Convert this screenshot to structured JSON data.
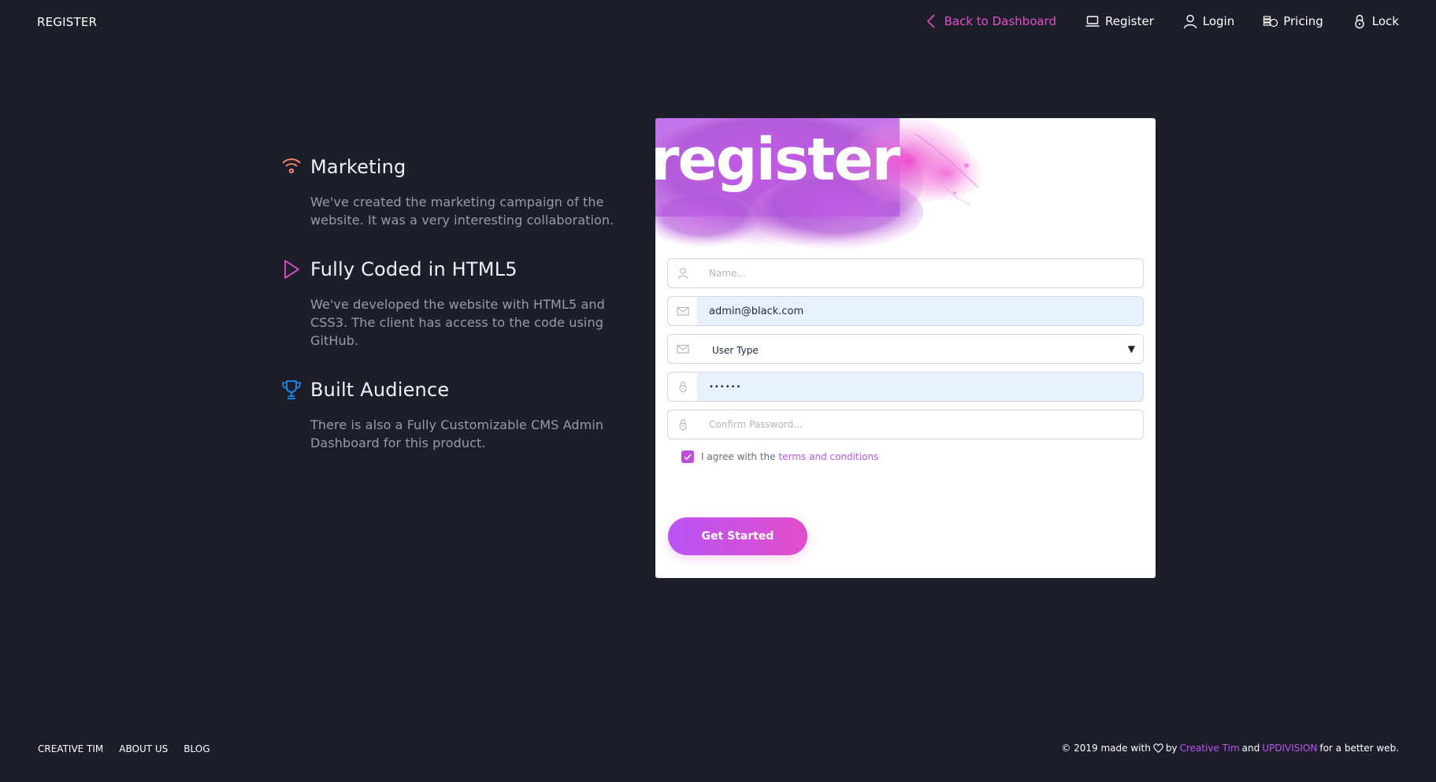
{
  "navbar": {
    "brand": "REGISTER",
    "items": [
      {
        "label": "Back to Dashboard",
        "icon": "chevron-left-icon",
        "color": "#e14eca"
      },
      {
        "label": "Register",
        "icon": "laptop-icon"
      },
      {
        "label": "Login",
        "icon": "user-icon"
      },
      {
        "label": "Pricing",
        "icon": "coins-icon"
      },
      {
        "label": "Lock",
        "icon": "lock-icon"
      }
    ]
  },
  "info": [
    {
      "title": "Marketing",
      "description": "We've created the marketing campaign of the website. It was a very interesting collaboration.",
      "icon": "wifi-icon",
      "icon_color": "#ff8d72"
    },
    {
      "title": "Fully Coded in HTML5",
      "description": "We've developed the website with HTML5 and CSS3. The client has access to the code using GitHub.",
      "icon": "play-icon",
      "icon_color": "#e14eca"
    },
    {
      "title": "Built Audience",
      "description": "There is also a Fully Customizable CMS Admin Dashboard for this product.",
      "icon": "trophy-icon",
      "icon_color": "#1d8cf8"
    }
  ],
  "card": {
    "title": "register",
    "fields": {
      "name": {
        "placeholder": "Name...",
        "icon": "user-icon"
      },
      "email": {
        "value": "admin@black.com",
        "icon": "email-icon"
      },
      "user_type": {
        "value": "User Type",
        "icon": "email-icon"
      },
      "password": {
        "value": "••••••",
        "icon": "lock-icon"
      },
      "confirm_password": {
        "placeholder": "Confirm Password...",
        "icon": "lock-icon"
      }
    },
    "agree": {
      "text": "I agree with the",
      "link": "terms and conditions",
      "checked": true
    },
    "submit_label": "Get Started"
  },
  "footer": {
    "links": [
      "CREATIVE TIM",
      "ABOUT US",
      "BLOG"
    ],
    "copyright": {
      "prefix": "© 2019 made with",
      "by": "by",
      "author1": "Creative Tim",
      "and": "and",
      "author2": "UPDIVISION",
      "suffix": "for a better web."
    }
  },
  "colors": {
    "background": "#1e1e2b",
    "primary": "#e14eca",
    "info": "#1d8cf8",
    "accent_purple": "#ba54f5"
  }
}
